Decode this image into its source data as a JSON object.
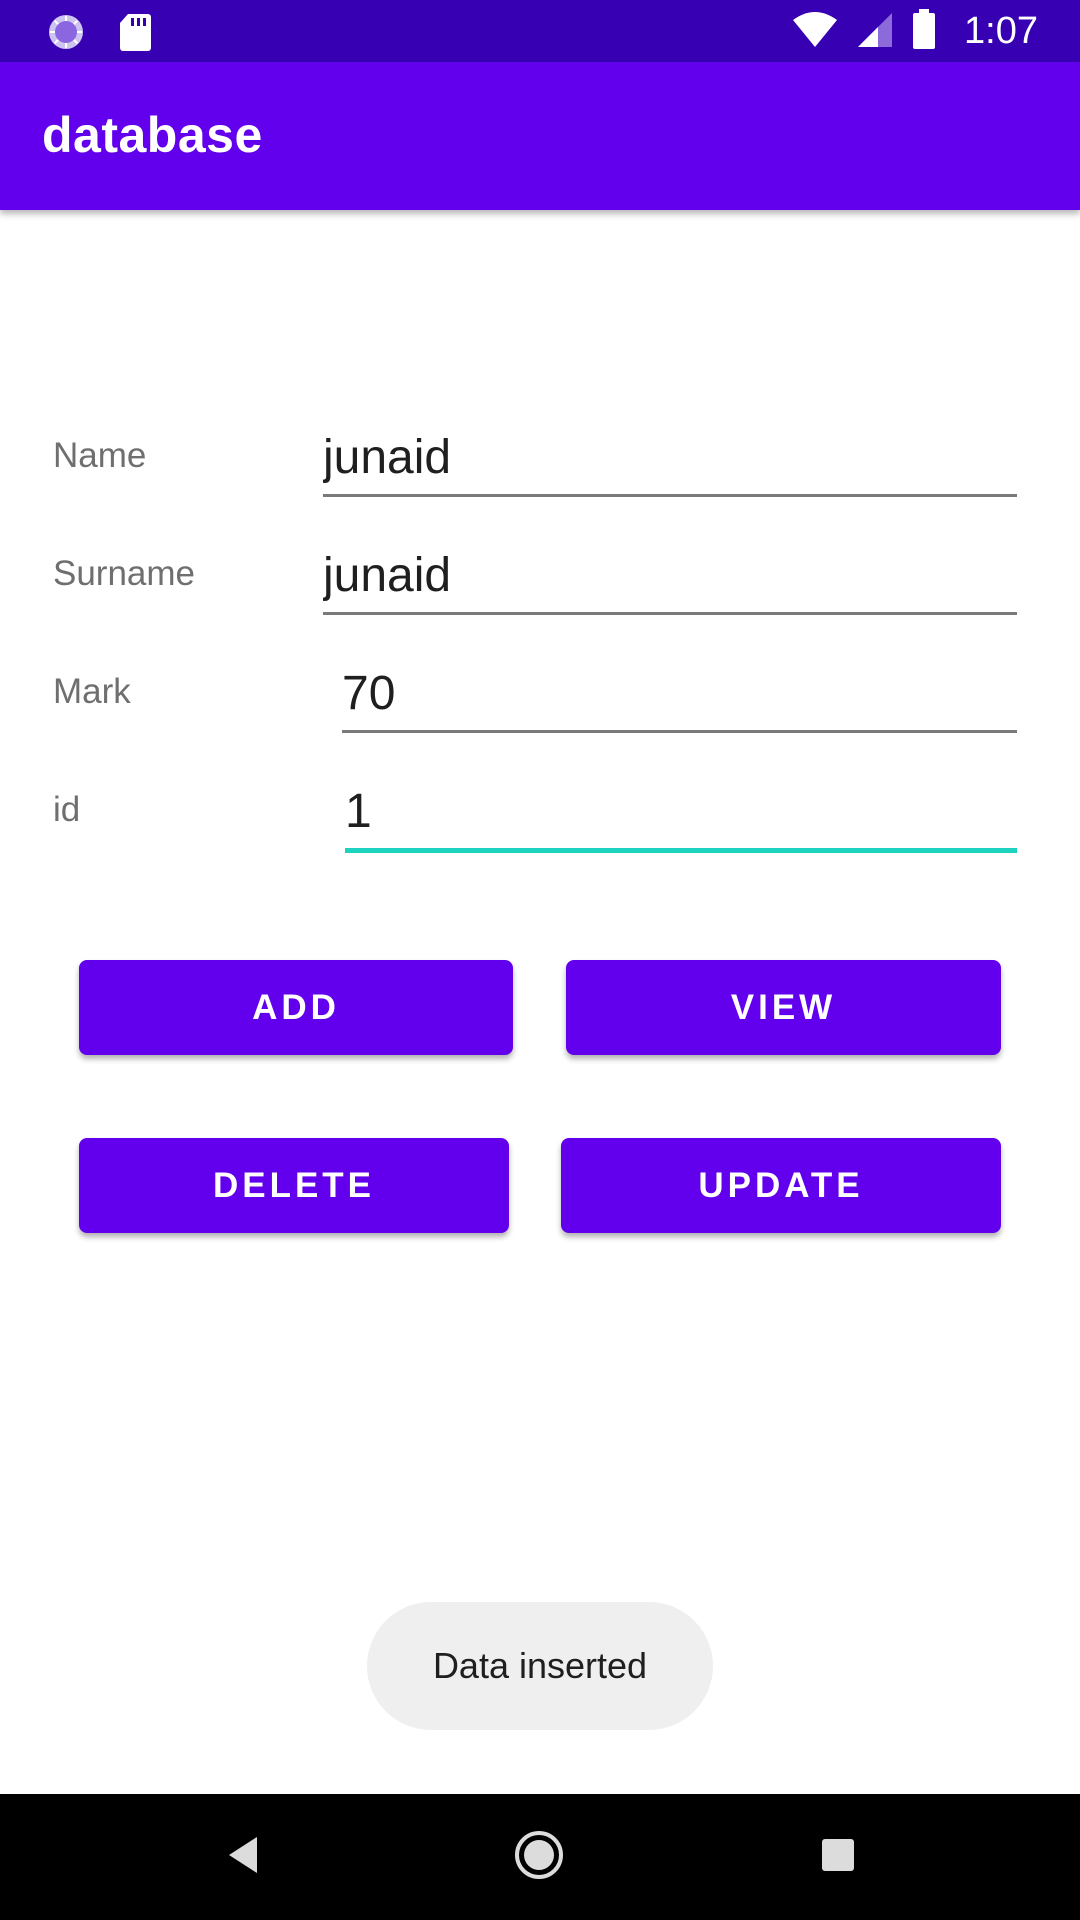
{
  "status_bar": {
    "time": "1:07",
    "icons": [
      "loading-circle-icon",
      "sd-card-icon",
      "wifi-icon",
      "signal-icon",
      "battery-icon"
    ]
  },
  "app_bar": {
    "title": "database"
  },
  "form": {
    "fields": [
      {
        "label": "Name",
        "value": "junaid"
      },
      {
        "label": "Surname",
        "value": "junaid"
      },
      {
        "label": "Mark",
        "value": "70"
      },
      {
        "label": "id",
        "value": "1"
      }
    ]
  },
  "buttons": {
    "add": "ADD",
    "view": "VIEW",
    "delete": "DELETE",
    "update": "UPDATE"
  },
  "toast": {
    "message": "Data inserted"
  },
  "nav_bar": {
    "icons": [
      "back-icon",
      "home-icon",
      "recents-icon"
    ]
  },
  "colors": {
    "status_bar": "#3700b3",
    "primary": "#6200ee",
    "focus_accent": "#1dd3c0",
    "toast_bg": "#efefef",
    "nav_bar": "#000000"
  }
}
